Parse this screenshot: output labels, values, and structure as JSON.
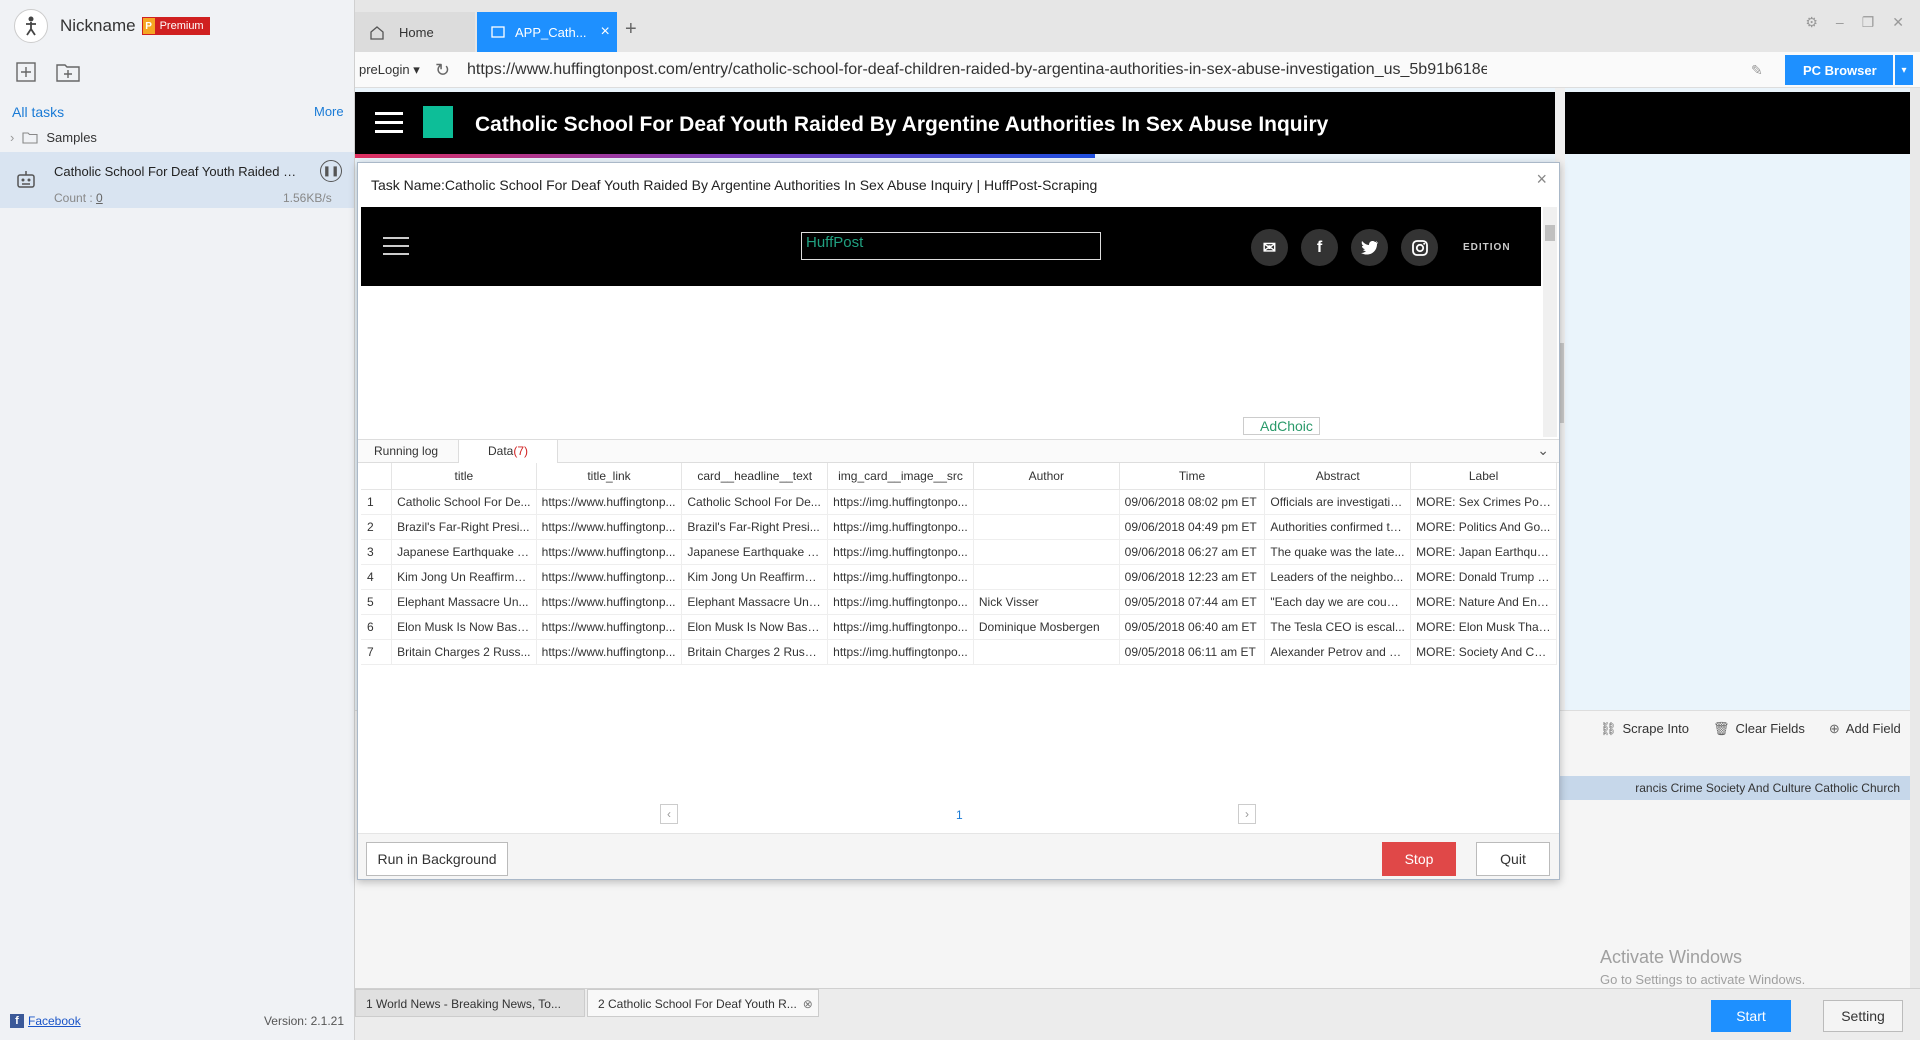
{
  "app": {
    "nickname": "Nickname",
    "premium_badge_letter": "P",
    "premium_label": "Premium",
    "version": "Version: 2.1.21",
    "facebook_label": "Facebook"
  },
  "sidebar": {
    "all_tasks": "All tasks",
    "more": "More",
    "folder": "Samples",
    "task": {
      "title": "Catholic School For Deaf Youth Raided By ...",
      "count_label": "Count : ",
      "count_value": "0",
      "speed": "1.56KB/s"
    }
  },
  "tabs": [
    {
      "label": "Home"
    },
    {
      "label": "APP_Cath..."
    }
  ],
  "addressbar": {
    "prelogin": "preLogin",
    "url": "https://www.huffingtonpost.com/entry/catholic-school-for-deaf-children-raided-by-argentina-authorities-in-sex-abuse-investigation_us_5b91b618e4b0511db3e0abe0",
    "pc_browser": "PC Browser"
  },
  "page": {
    "headline": "Catholic School For Deaf Youth Raided By Argentine Authorities In Sex Abuse Inquiry"
  },
  "lower_panel": {
    "scrape_into": "Scrape Into",
    "clear_fields": "Clear Fields",
    "add_field": "Add Field",
    "highlight_text": "rancis Crime Society And Culture Catholic Church",
    "activate_title": "Activate Windows",
    "activate_sub": "Go to Settings to activate Windows."
  },
  "bottom_tabs": [
    {
      "label": "1 World News - Breaking News, To..."
    },
    {
      "label": "2 Catholic School For Deaf Youth R..."
    }
  ],
  "bottom_buttons": {
    "start": "Start",
    "setting": "Setting"
  },
  "dialog": {
    "title": "Task Name:Catholic School For Deaf Youth Raided By Argentine Authorities In Sex Abuse Inquiry | HuffPost-Scraping",
    "preview": {
      "logo_alt": "HuffPost",
      "edition": "EDITION",
      "adchoice": "AdChoic"
    },
    "tab_log": "Running log",
    "tab_data": "Data",
    "tab_data_count": "(7)",
    "columns": [
      "",
      "title",
      "title_link",
      "card__headline__text",
      "img_card__image__src",
      "Author",
      "Time",
      "Abstract",
      "Label"
    ],
    "rows": [
      [
        "1",
        "Catholic School For De...",
        "https://www.huffingtonp...",
        "Catholic School For De...",
        "https://img.huffingtonpo...",
        "",
        "09/06/2018 08:02 pm ET",
        "Officials are investigatin...",
        "MORE: Sex Crimes Pop..."
      ],
      [
        "2",
        "Brazil's Far-Right Presi...",
        "https://www.huffingtonp...",
        "Brazil's Far-Right Presi...",
        "https://img.huffingtonpo...",
        "",
        "09/06/2018 04:49 pm ET",
        "Authorities confirmed th...",
        "MORE: Politics And Go..."
      ],
      [
        "3",
        "Japanese Earthquake T...",
        "https://www.huffingtonp...",
        "Japanese Earthquake T...",
        "https://img.huffingtonpo...",
        "",
        "09/06/2018 06:27 am ET",
        "The quake was the late...",
        "MORE: Japan Earthqua..."
      ],
      [
        "4",
        "Kim Jong Un Reaffirms ...",
        "https://www.huffingtonp...",
        "Kim Jong Un Reaffirms ...",
        "https://img.huffingtonpo...",
        "",
        "09/06/2018 12:23 am ET",
        "Leaders of the neighbo...",
        "MORE: Donald Trump P..."
      ],
      [
        "5",
        "Elephant Massacre Un...",
        "https://www.huffingtonp...",
        "Elephant Massacre Und...",
        "https://img.huffingtonpo...",
        "Nick Visser",
        "09/05/2018 07:44 am ET",
        "\"Each day we are count...",
        "MORE: Nature And Env..."
      ],
      [
        "6",
        "Elon Musk Is Now Base...",
        "https://www.huffingtonp...",
        "Elon Musk Is Now Base...",
        "https://img.huffingtonpo...",
        "Dominique Mosbergen",
        "09/05/2018 06:40 am ET",
        "The Tesla CEO is escal...",
        "MORE: Elon Musk Thail..."
      ],
      [
        "7",
        "Britain Charges 2 Russ...",
        "https://www.huffingtonp...",
        "Britain Charges 2 Russi...",
        "https://img.huffingtonpo...",
        "",
        "09/05/2018 06:11 am ET",
        "Alexander Petrov and R...",
        "MORE: Society And Cul..."
      ]
    ],
    "page_number": "1",
    "run_background": "Run in Background",
    "stop": "Stop",
    "quit": "Quit"
  }
}
